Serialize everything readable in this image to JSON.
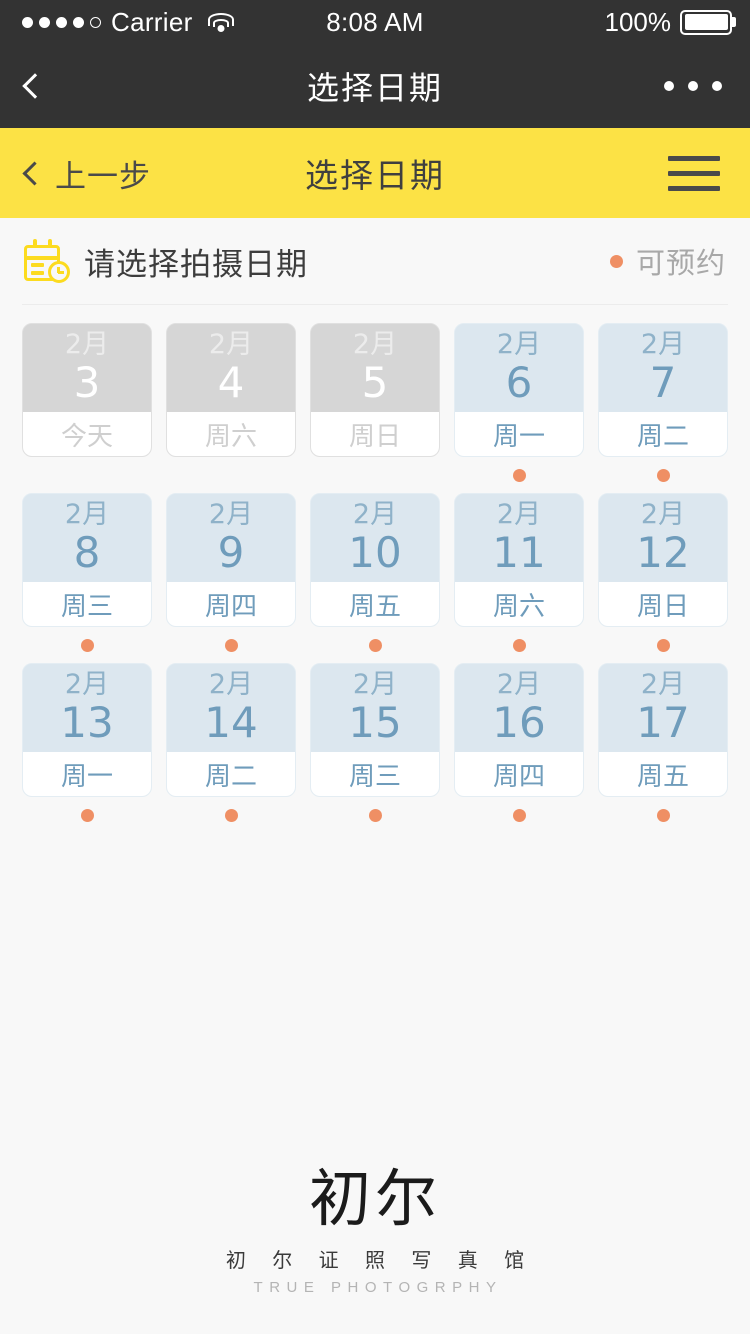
{
  "status_bar": {
    "carrier": "Carrier",
    "time": "8:08 AM",
    "battery_percent": "100%",
    "signal_filled": 4,
    "signal_total": 5
  },
  "nav_bar": {
    "title": "选择日期"
  },
  "app_bar": {
    "back_label": "上一步",
    "title": "选择日期",
    "background_color": "#fce245"
  },
  "section": {
    "title": "请选择拍摄日期",
    "legend_label": "可预约",
    "legend_color": "#ef8f64"
  },
  "dates": [
    {
      "month": "2月",
      "day": "3",
      "weekday": "今天",
      "state": "disabled",
      "available": false
    },
    {
      "month": "2月",
      "day": "4",
      "weekday": "周六",
      "state": "disabled",
      "available": false
    },
    {
      "month": "2月",
      "day": "5",
      "weekday": "周日",
      "state": "disabled",
      "available": false
    },
    {
      "month": "2月",
      "day": "6",
      "weekday": "周一",
      "state": "available",
      "available": true
    },
    {
      "month": "2月",
      "day": "7",
      "weekday": "周二",
      "state": "available",
      "available": true
    },
    {
      "month": "2月",
      "day": "8",
      "weekday": "周三",
      "state": "available",
      "available": true
    },
    {
      "month": "2月",
      "day": "9",
      "weekday": "周四",
      "state": "available",
      "available": true
    },
    {
      "month": "2月",
      "day": "10",
      "weekday": "周五",
      "state": "available",
      "available": true
    },
    {
      "month": "2月",
      "day": "11",
      "weekday": "周六",
      "state": "available",
      "available": true
    },
    {
      "month": "2月",
      "day": "12",
      "weekday": "周日",
      "state": "available",
      "available": true
    },
    {
      "month": "2月",
      "day": "13",
      "weekday": "周一",
      "state": "available",
      "available": true
    },
    {
      "month": "2月",
      "day": "14",
      "weekday": "周二",
      "state": "available",
      "available": true
    },
    {
      "month": "2月",
      "day": "15",
      "weekday": "周三",
      "state": "available",
      "available": true
    },
    {
      "month": "2月",
      "day": "16",
      "weekday": "周四",
      "state": "available",
      "available": true
    },
    {
      "month": "2月",
      "day": "17",
      "weekday": "周五",
      "state": "available",
      "available": true
    }
  ],
  "footer": {
    "logo_mark": "初尔",
    "logo_cn": "初 尔 证 照 写 真 馆",
    "logo_en": "TRUE PHOTOGRPHY"
  }
}
